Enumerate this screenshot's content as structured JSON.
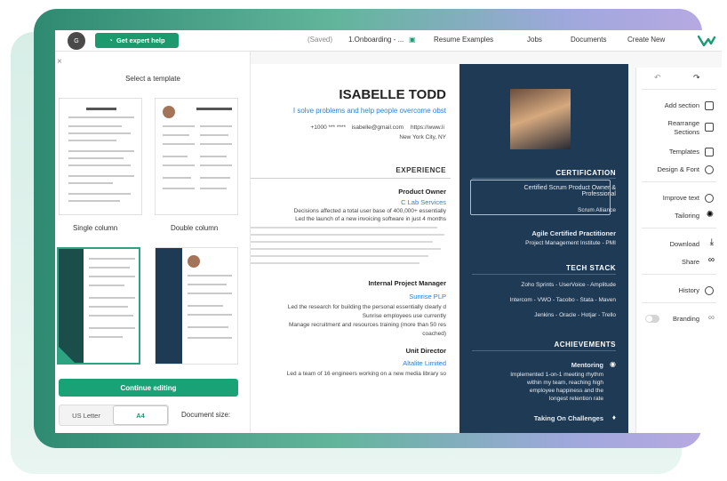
{
  "topbar": {
    "avatar": "G",
    "expert_button": "Get expert help",
    "saved": "(Saved)",
    "breadcrumb_doc": "1.Onboarding - ...",
    "nav": [
      "Resume Examples",
      "Jobs",
      "Documents",
      "Create New"
    ]
  },
  "templates": {
    "title": "Select a template",
    "close": "×",
    "single_column": "Single column",
    "double_column": "Double column",
    "continue": "Continue editing",
    "size_label": "Document size:",
    "sizes": [
      "US Letter",
      "A4"
    ]
  },
  "resume": {
    "name": "ISABELLE TODD",
    "tagline": "I solve problems and help people overcome obst",
    "phone": "+1000 *** ****",
    "email": "isabelle@gmail.com",
    "url": "https://www.li",
    "location": "New York City, NY",
    "experience_heading": "EXPERIENCE",
    "jobs": [
      {
        "title": "Product Owner",
        "company": "C Lab Services",
        "bullets": [
          "Decisions affected a total user base of 400,000+ essentially",
          "Led the launch of a new invoicing software in just 4 months"
        ]
      },
      {
        "title": "Internal Project Manager",
        "company": "Sunrise PLP",
        "bullets": [
          "Led the research for building the personal essentially clearly d",
          "Sunrise employees use currently",
          "Manage recruitment and resources training (more than 50 res",
          "coached)"
        ]
      },
      {
        "title": "Unit Director",
        "company": "Altalite Limited",
        "bullets": [
          "Led a team of 16 engineers working on a new media library so"
        ]
      }
    ],
    "side": {
      "certification_heading": "CERTIFICATION",
      "cert1": "Certified Scrum Product Owner & Professional",
      "cert1_org": "Scrum Alliance",
      "cert2": "Agile Certified Practitioner",
      "cert2_org": "Project Management Institute - PMI",
      "tech_heading": "TECH STACK",
      "tech": [
        "Zoho Sprints - UserVoice - Amplitude",
        "Intercom - VWO - Tacobo - Stata - Maven",
        "Jenkins - Oracle - Hotjar - Trello"
      ],
      "ach_heading": "ACHIEVEMENTS",
      "ach1_title": "Mentoring",
      "ach1_text": [
        "Implemented 1-on-1 meeting rhythm",
        "within my team, reaching high",
        "employee happiness and the",
        "longest retention rate"
      ],
      "ach2_title": "Taking On Challenges"
    }
  },
  "toolbar": {
    "items": [
      "Add section",
      "Rearrange Sections",
      "Templates",
      "Design & Font",
      "Improve text",
      "Tailoring",
      "Download",
      "Share",
      "History",
      "Branding"
    ]
  }
}
